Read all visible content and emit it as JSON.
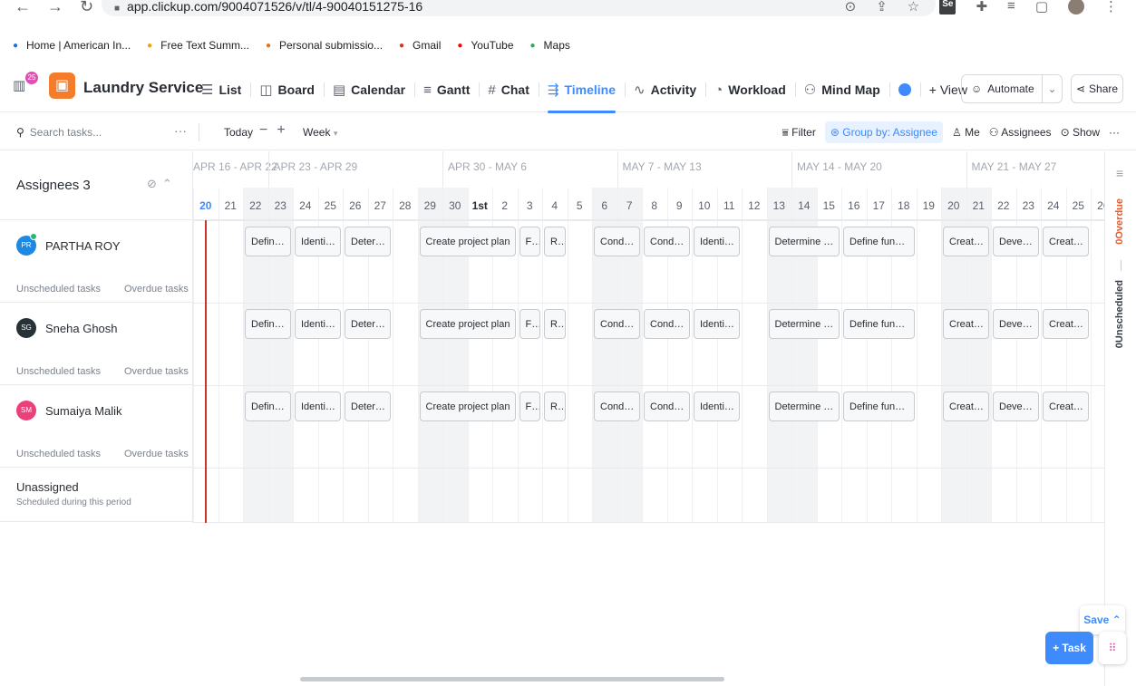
{
  "browser": {
    "url": "app.clickup.com/9004071526/v/tl/4-90040151275-16",
    "bookmarks": [
      {
        "label": "Home | American In...",
        "icon": "globe-icon",
        "color": "#1a73e8"
      },
      {
        "label": "Free Text Summ...",
        "icon": "summarizer-icon",
        "color": "#f4a100"
      },
      {
        "label": "Personal submissio...",
        "icon": "bar-chart-icon",
        "color": "#e8710a"
      },
      {
        "label": "Gmail",
        "icon": "gmail-icon",
        "color": "#d93025"
      },
      {
        "label": "YouTube",
        "icon": "youtube-icon",
        "color": "#ff0000"
      },
      {
        "label": "Maps",
        "icon": "maps-pin-icon",
        "color": "#34a853"
      }
    ],
    "ext_badge": "Se"
  },
  "app": {
    "hub_badge": "25",
    "space_name": "Laundry Service",
    "views": [
      {
        "label": "List",
        "icon": "list-icon",
        "glyph": "☰"
      },
      {
        "label": "Board",
        "icon": "board-icon",
        "glyph": "◫"
      },
      {
        "label": "Calendar",
        "icon": "calendar-icon",
        "glyph": "▤"
      },
      {
        "label": "Gantt",
        "icon": "gantt-icon",
        "glyph": "≡"
      },
      {
        "label": "Chat",
        "icon": "hashtag-icon",
        "glyph": "#"
      },
      {
        "label": "Timeline",
        "icon": "timeline-icon",
        "glyph": "⇶",
        "active": true
      },
      {
        "label": "Activity",
        "icon": "activity-icon",
        "glyph": "∿"
      },
      {
        "label": "Workload",
        "icon": "gauge-icon",
        "glyph": "◔"
      },
      {
        "label": "Mind Map",
        "icon": "mind-map-icon",
        "glyph": "⚇"
      }
    ],
    "add_view": "+ View",
    "automate": "Automate",
    "share": "Share",
    "accent": "#3d8bfd"
  },
  "toolbar": {
    "search_placeholder": "Search tasks...",
    "today": "Today",
    "zoom_out": "−",
    "zoom_in": "+",
    "scale": "Week",
    "filter": "Filter",
    "group_by": "Group by: Assignee",
    "me": "Me",
    "assignees": "Assignees",
    "show": "Show"
  },
  "timeline": {
    "assignees_label": "Assignees 3",
    "week_ranges": [
      "APR 16 - APR 22",
      "APR 23 - APR 29",
      "APR 30 - MAY 6",
      "MAY 7 - MAY 13",
      "MAY 14 - MAY 20",
      "MAY 21 - MAY 27"
    ],
    "days": [
      "20",
      "21",
      "22",
      "23",
      "24",
      "25",
      "26",
      "27",
      "28",
      "29",
      "30",
      "1st",
      "2",
      "3",
      "4",
      "5",
      "6",
      "7",
      "8",
      "9",
      "10",
      "11",
      "12",
      "13",
      "14",
      "15",
      "16",
      "17",
      "18",
      "19",
      "20",
      "21",
      "22",
      "23",
      "24",
      "25",
      "26"
    ],
    "today_day": "20",
    "people": [
      {
        "name": "PARTHA ROY",
        "initials": "PR",
        "color": "#1e88e5",
        "online": true
      },
      {
        "name": "Sneha Ghosh",
        "initials": "SG",
        "color": "#263238",
        "online": false
      },
      {
        "name": "Sumaiya Malik",
        "initials": "SM",
        "color": "#ec407a",
        "online": false
      }
    ],
    "unscheduled_label": "Unscheduled tasks",
    "overdue_label": "Overdue tasks",
    "tasks": [
      {
        "label": "Define ...",
        "start": 2,
        "span": 2
      },
      {
        "label": "Identify...",
        "start": 4,
        "span": 2
      },
      {
        "label": "Determ...",
        "start": 6,
        "span": 2
      },
      {
        "label": "Create project plan",
        "start": 9,
        "span": 4
      },
      {
        "label": "Fi...",
        "start": 13,
        "span": 1
      },
      {
        "label": "R...",
        "start": 14,
        "span": 1
      },
      {
        "label": "Condu...",
        "start": 16,
        "span": 2
      },
      {
        "label": "Condu...",
        "start": 18,
        "span": 2
      },
      {
        "label": "Identify...",
        "start": 20,
        "span": 2
      },
      {
        "label": "Determine te...",
        "start": 23,
        "span": 3
      },
      {
        "label": "Define functi...",
        "start": 26,
        "span": 3
      },
      {
        "label": "Create ...",
        "start": 30,
        "span": 2
      },
      {
        "label": "Develo...",
        "start": 32,
        "span": 2
      },
      {
        "label": "Create ...",
        "start": 34,
        "span": 2
      }
    ],
    "unassigned_title": "Unassigned",
    "unassigned_sub": "Scheduled during this period"
  },
  "rail": {
    "overdue": "0Overdue",
    "unscheduled": "0Unscheduled"
  },
  "fab": {
    "save": "Save",
    "task": "+ Task"
  }
}
